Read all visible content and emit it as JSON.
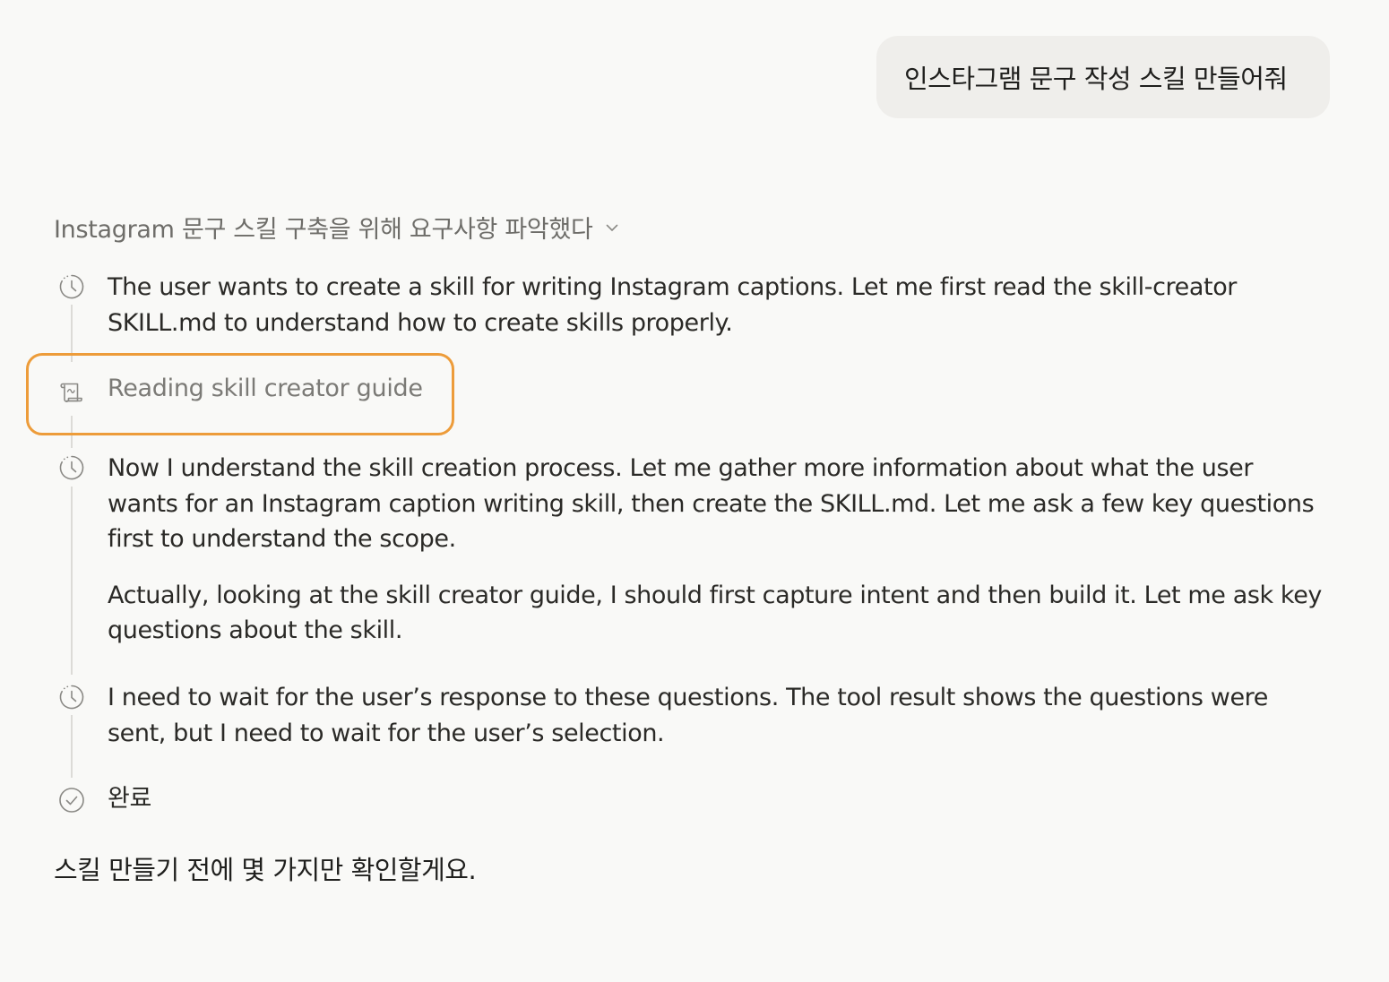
{
  "user_message": "인스타그램 문구 작성 스킬 만들어줘",
  "thinking": {
    "summary": "Instagram 문구 스킬 구축을 위해 요구사항 파악했다",
    "chevron_icon": "chevron-down-icon",
    "steps": [
      {
        "icon": "clock-icon",
        "paragraphs": [
          "The user wants to create a skill for writing Instagram captions. Let me first read the skill-creator SKILL.md to understand how to create skills properly."
        ]
      },
      {
        "icon": "scroll-icon",
        "label": "Reading skill creator guide"
      },
      {
        "icon": "clock-icon",
        "paragraphs": [
          "Now I understand the skill creation process. Let me gather more information about what the user wants for an Instagram caption writing skill, then create the SKILL.md. Let me ask a few key questions first to understand the scope.",
          "Actually, looking at the skill creator guide, I should first capture intent and then build it. Let me ask key questions about the skill."
        ]
      },
      {
        "icon": "clock-icon",
        "paragraphs": [
          "I need to wait for the user’s response to these questions. The tool result shows the questions were sent, but I need to wait for the user’s selection."
        ]
      },
      {
        "icon": "check-circle-icon",
        "label": "완료"
      }
    ]
  },
  "assistant_reply": "스킬 만들기 전에 몇 가지만 확인할게요.",
  "colors": {
    "background": "#f9f9f7",
    "user_bubble": "#efeeeb",
    "highlight": "#ed9c3a",
    "muted_text": "#6e6d69"
  }
}
